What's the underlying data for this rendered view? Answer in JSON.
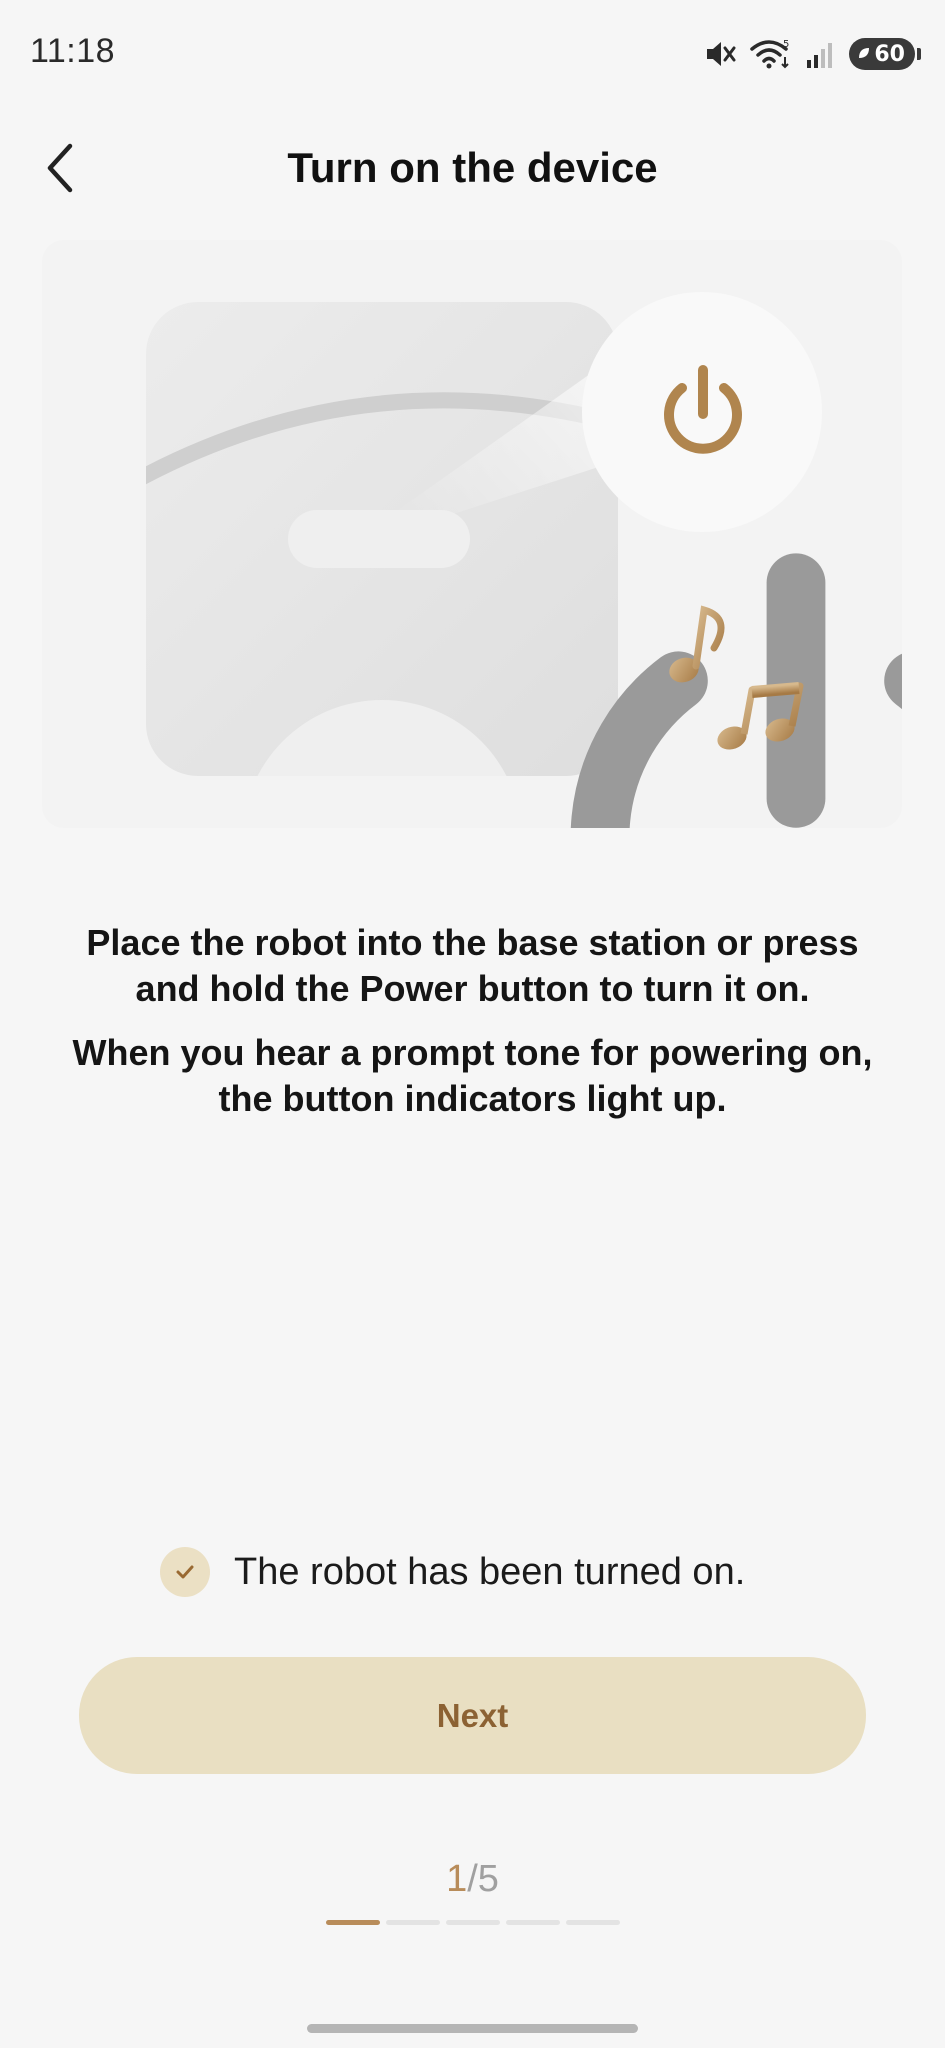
{
  "status_bar": {
    "time": "11:18",
    "battery_level": "60",
    "icons": [
      "mute-icon",
      "wifi-icon",
      "signal-icon",
      "battery-icon"
    ]
  },
  "header": {
    "title": "Turn on the device",
    "back_icon": "chevron-left-icon"
  },
  "illustration": {
    "icons": [
      "power-icon",
      "music-note-icon"
    ],
    "accent_color": "#b88c5a"
  },
  "instructions": {
    "line1": "Place the robot into the base station or press and hold the Power button to turn it on.",
    "line2": "When you hear a prompt tone for powering on, the button indicators light up."
  },
  "confirmation": {
    "label": "The robot has been turned on.",
    "checked": true
  },
  "next_button": {
    "label": "Next"
  },
  "progress": {
    "current": "1",
    "total": "/5",
    "current_step": 1,
    "total_steps": 5
  }
}
